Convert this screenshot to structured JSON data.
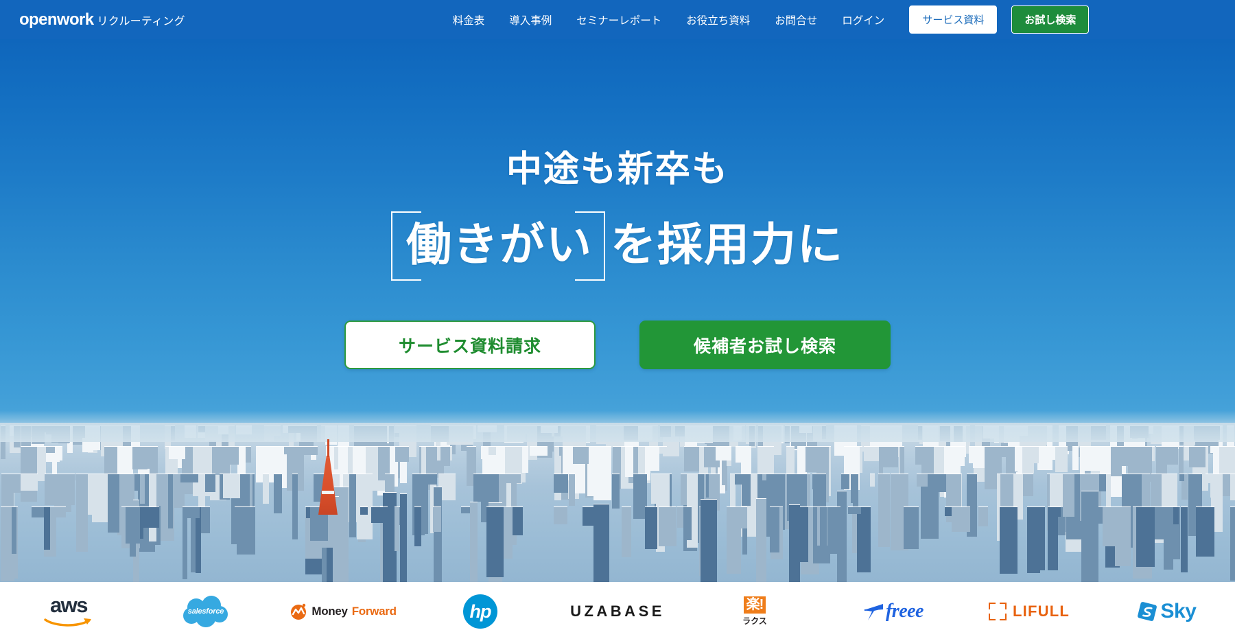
{
  "header": {
    "brand_mark": "openwork",
    "brand_sub": "リクルーティング",
    "nav": [
      {
        "label": "料金表"
      },
      {
        "label": "導入事例"
      },
      {
        "label": "セミナーレポート"
      },
      {
        "label": "お役立ち資料"
      },
      {
        "label": "お問合せ"
      },
      {
        "label": "ログイン"
      }
    ],
    "doc_button": "サービス資料",
    "trial_button": "お試し検索",
    "bg_color": "#1266bd",
    "trial_color": "#1e8c3c"
  },
  "hero": {
    "line1": "中途も新卒も",
    "bracketed": "働きがい",
    "line2_tail": "を採用力に",
    "cta_primary": "サービス資料請求",
    "cta_secondary": "候補者お試し検索",
    "sky_top_color": "#0f66bc",
    "sky_bottom_color": "#bcdcee",
    "green_color": "#229637"
  },
  "logos": [
    {
      "name": "aws",
      "text": "aws"
    },
    {
      "name": "salesforce",
      "text": "salesforce"
    },
    {
      "name": "money-forward",
      "text_1": "Money",
      "text_2": "Forward"
    },
    {
      "name": "hp",
      "text": "hp"
    },
    {
      "name": "uzabase",
      "text": "UZABASE"
    },
    {
      "name": "rakus",
      "text_1": "楽!",
      "text_2": "ラクス"
    },
    {
      "name": "freee",
      "text": "freee"
    },
    {
      "name": "lifull",
      "text": "LIFULL"
    },
    {
      "name": "sky",
      "text": "Sky"
    }
  ]
}
